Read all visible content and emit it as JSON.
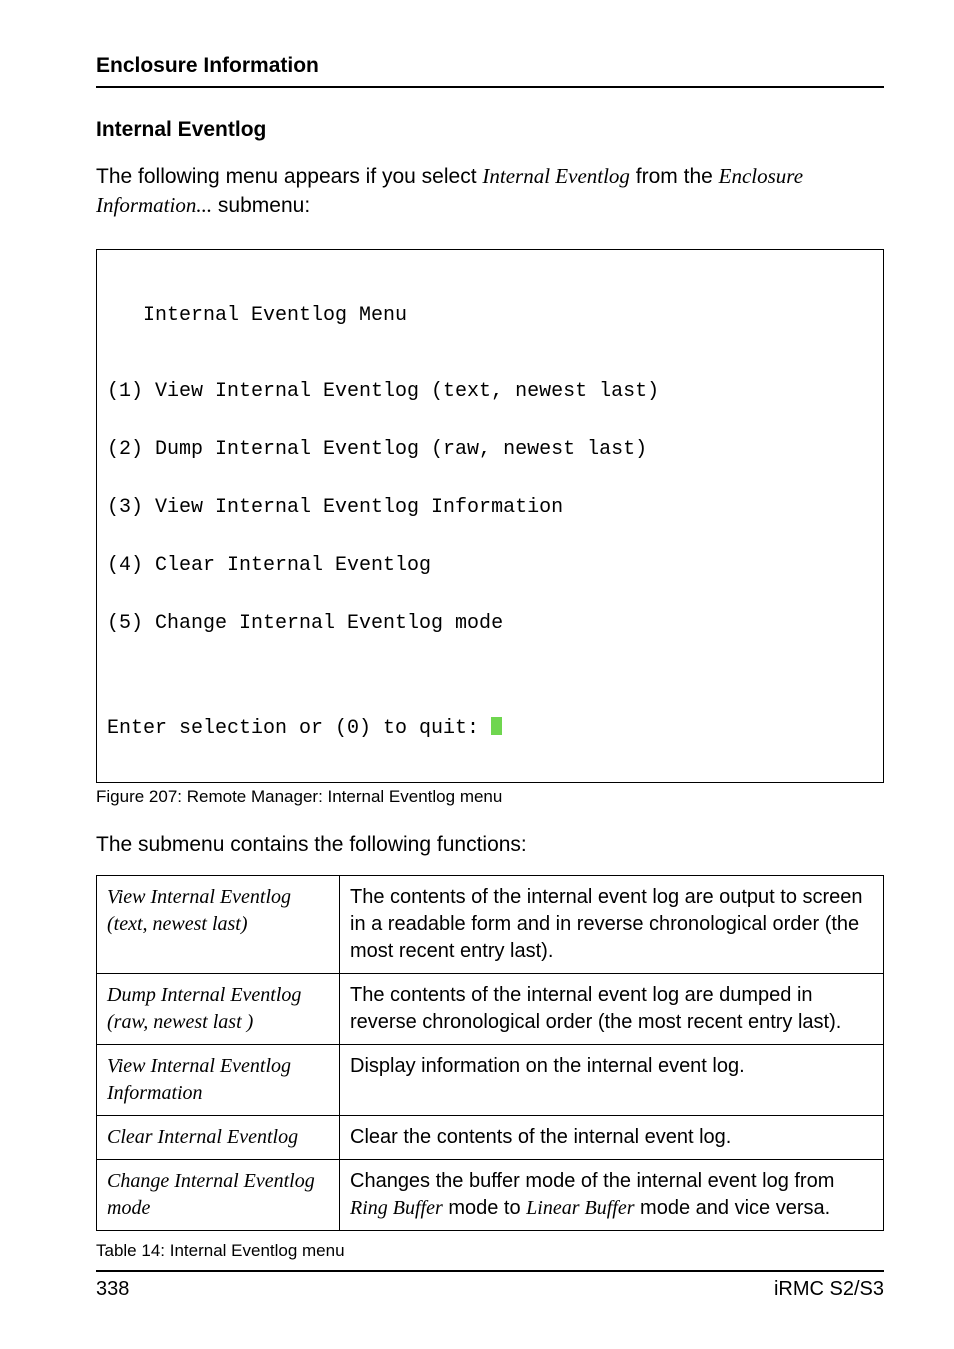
{
  "header": {
    "title": "Enclosure Information"
  },
  "section": {
    "heading": "Internal Eventlog",
    "intro_prefix": "The following menu appears if you select ",
    "intro_italic1": "Internal Eventlog",
    "intro_mid": " from the ",
    "intro_italic2": "Enclosure Information...",
    "intro_suffix": " submenu:"
  },
  "terminal": {
    "title": "Internal Eventlog Menu",
    "lines": [
      "(1) View Internal Eventlog (text, newest last)",
      "(2) Dump Internal Eventlog (raw, newest last)",
      "(3) View Internal Eventlog Information",
      "(4) Clear Internal Eventlog",
      "(5) Change Internal Eventlog mode"
    ],
    "prompt": "Enter selection or (0) to quit: "
  },
  "figure_caption": "Figure 207: Remote Manager: Internal Eventlog menu",
  "subtext": "The submenu contains the following functions:",
  "table": {
    "rows": [
      {
        "label": "View Internal Eventlog (text, newest last)",
        "desc": "The contents of the internal event log are output to screen in a readable form and in reverse chronological order (the most recent entry last)."
      },
      {
        "label": "Dump Internal Eventlog (raw, newest last )",
        "desc": "The contents of the internal event log are dumped in reverse chronological order (the most recent entry last)."
      },
      {
        "label": "View Internal Eventlog Information",
        "desc": "Display information on the internal event log."
      },
      {
        "label": "Clear Internal Eventlog",
        "desc": "Clear the contents of the internal event log."
      },
      {
        "label": "Change Internal Eventlog mode",
        "desc_prefix": "Changes the buffer mode of the internal event log from ",
        "desc_i1": "Ring Buffer",
        "desc_mid": " mode to ",
        "desc_i2": "Linear Buffer",
        "desc_suffix": " mode and vice versa."
      }
    ]
  },
  "table_caption": "Table 14:  Internal Eventlog menu",
  "footer": {
    "page_number": "338",
    "product": "iRMC S2/S3"
  }
}
